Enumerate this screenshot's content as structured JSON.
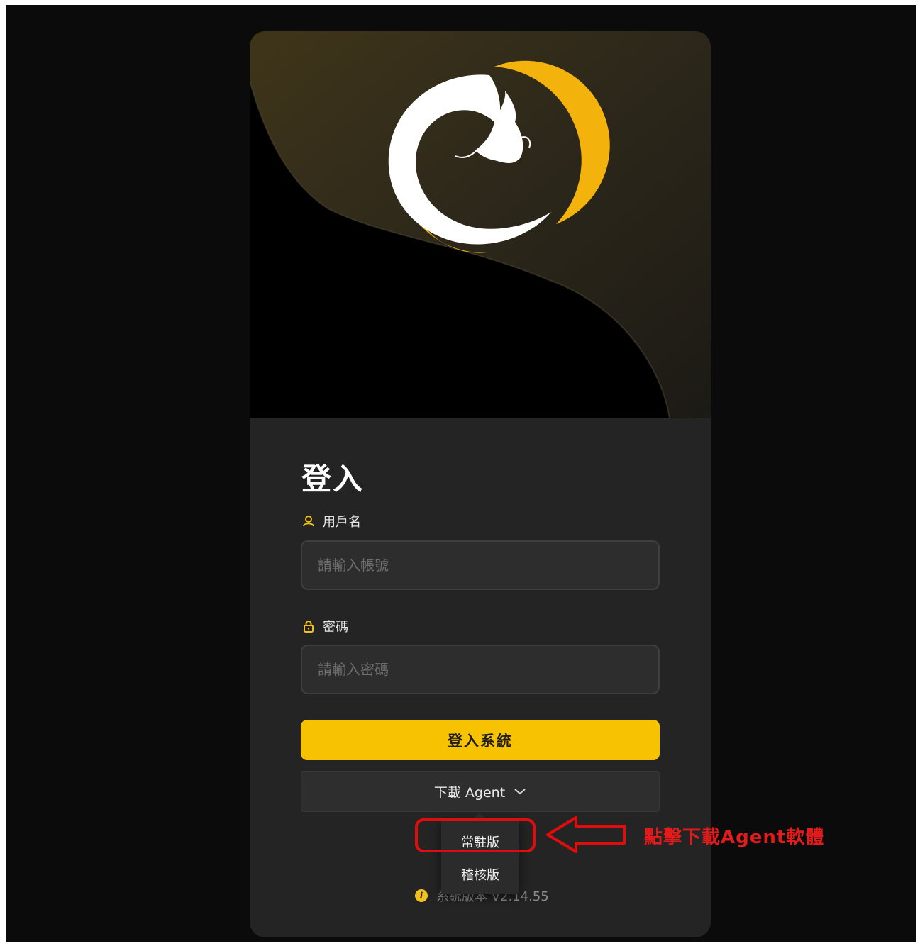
{
  "login": {
    "title": "登入",
    "username_label": "用戶名",
    "username_placeholder": "請輸入帳號",
    "password_label": "密碼",
    "password_placeholder": "請輸入密碼",
    "submit_label": "登入系統",
    "download_label": "下載 Agent"
  },
  "download_menu": {
    "items": [
      "常駐版",
      "稽核版"
    ]
  },
  "version": {
    "text": "系統版本 V2.14.55"
  },
  "annotation": {
    "text": "點擊下載Agent軟體",
    "color": "#e00d0d"
  },
  "icons": {
    "logo": "dragon-logo-icon",
    "user": "user-icon",
    "lock": "lock-icon",
    "chevron": "chevron-down-icon",
    "info": "info-icon"
  },
  "colors": {
    "accent": "#f6c201",
    "background": "#0b0b0b",
    "card": "#242424",
    "field": "#2d2d2d"
  }
}
